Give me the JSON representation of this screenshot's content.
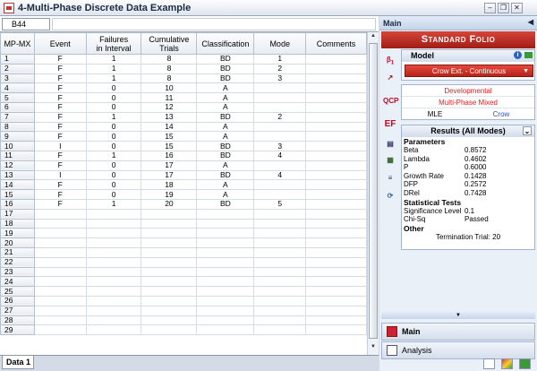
{
  "window": {
    "title": "4-Multi-Phase Discrete Data Example"
  },
  "cellbar": {
    "ref": "B44"
  },
  "columns": [
    "MP-MX",
    "Event",
    "Failures\nin Interval",
    "Cumulative\nTrials",
    "Classification",
    "Mode",
    "Comments"
  ],
  "rows": [
    {
      "n": "1",
      "event": "F",
      "fail": "1",
      "trials": "8",
      "cls": "BD",
      "mode": "1"
    },
    {
      "n": "2",
      "event": "F",
      "fail": "1",
      "trials": "8",
      "cls": "BD",
      "mode": "2"
    },
    {
      "n": "3",
      "event": "F",
      "fail": "1",
      "trials": "8",
      "cls": "BD",
      "mode": "3"
    },
    {
      "n": "4",
      "event": "F",
      "fail": "0",
      "trials": "10",
      "cls": "A",
      "mode": ""
    },
    {
      "n": "5",
      "event": "F",
      "fail": "0",
      "trials": "11",
      "cls": "A",
      "mode": ""
    },
    {
      "n": "6",
      "event": "F",
      "fail": "0",
      "trials": "12",
      "cls": "A",
      "mode": ""
    },
    {
      "n": "7",
      "event": "F",
      "fail": "1",
      "trials": "13",
      "cls": "BD",
      "mode": "2"
    },
    {
      "n": "8",
      "event": "F",
      "fail": "0",
      "trials": "14",
      "cls": "A",
      "mode": ""
    },
    {
      "n": "9",
      "event": "F",
      "fail": "0",
      "trials": "15",
      "cls": "A",
      "mode": ""
    },
    {
      "n": "10",
      "event": "I",
      "fail": "0",
      "trials": "15",
      "cls": "BD",
      "mode": "3"
    },
    {
      "n": "11",
      "event": "F",
      "fail": "1",
      "trials": "16",
      "cls": "BD",
      "mode": "4"
    },
    {
      "n": "12",
      "event": "F",
      "fail": "0",
      "trials": "17",
      "cls": "A",
      "mode": ""
    },
    {
      "n": "13",
      "event": "I",
      "fail": "0",
      "trials": "17",
      "cls": "BD",
      "mode": "4"
    },
    {
      "n": "14",
      "event": "F",
      "fail": "0",
      "trials": "18",
      "cls": "A",
      "mode": ""
    },
    {
      "n": "15",
      "event": "F",
      "fail": "0",
      "trials": "19",
      "cls": "A",
      "mode": ""
    },
    {
      "n": "16",
      "event": "F",
      "fail": "1",
      "trials": "20",
      "cls": "BD",
      "mode": "5"
    },
    {
      "n": "17"
    },
    {
      "n": "18"
    },
    {
      "n": "19"
    },
    {
      "n": "20"
    },
    {
      "n": "21"
    },
    {
      "n": "22"
    },
    {
      "n": "23"
    },
    {
      "n": "24"
    },
    {
      "n": "25"
    },
    {
      "n": "26"
    },
    {
      "n": "27"
    },
    {
      "n": "28"
    },
    {
      "n": "29"
    }
  ],
  "sheet_tab": "Data 1",
  "panel": {
    "title": "Main",
    "banner": "Standard Folio",
    "model_label": "Model",
    "model_value": "Crow Ext. - Continuous",
    "info_lines": [
      "Developmental",
      "Multi-Phase Mixed"
    ],
    "method": "MLE",
    "method2": "Crow",
    "results_title": "Results (All Modes)",
    "sections": [
      {
        "title": "Parameters",
        "rows": [
          [
            "Beta",
            "0.8572"
          ],
          [
            "Lambda",
            "0.4602"
          ],
          [
            "P",
            "0.6000"
          ],
          [
            "Growth Rate",
            "0.1428"
          ],
          [
            "DFP",
            "0.2572"
          ],
          [
            "DRel",
            "0.7428"
          ]
        ]
      },
      {
        "title": "Statistical Tests",
        "rows": [
          [
            "Significance Level",
            "0.1"
          ],
          [
            "Chi-Sq",
            "Passed"
          ]
        ]
      },
      {
        "title": "Other",
        "rows": []
      }
    ],
    "termination": "Termination Trial: 20",
    "nav": [
      "Main",
      "Analysis"
    ]
  }
}
